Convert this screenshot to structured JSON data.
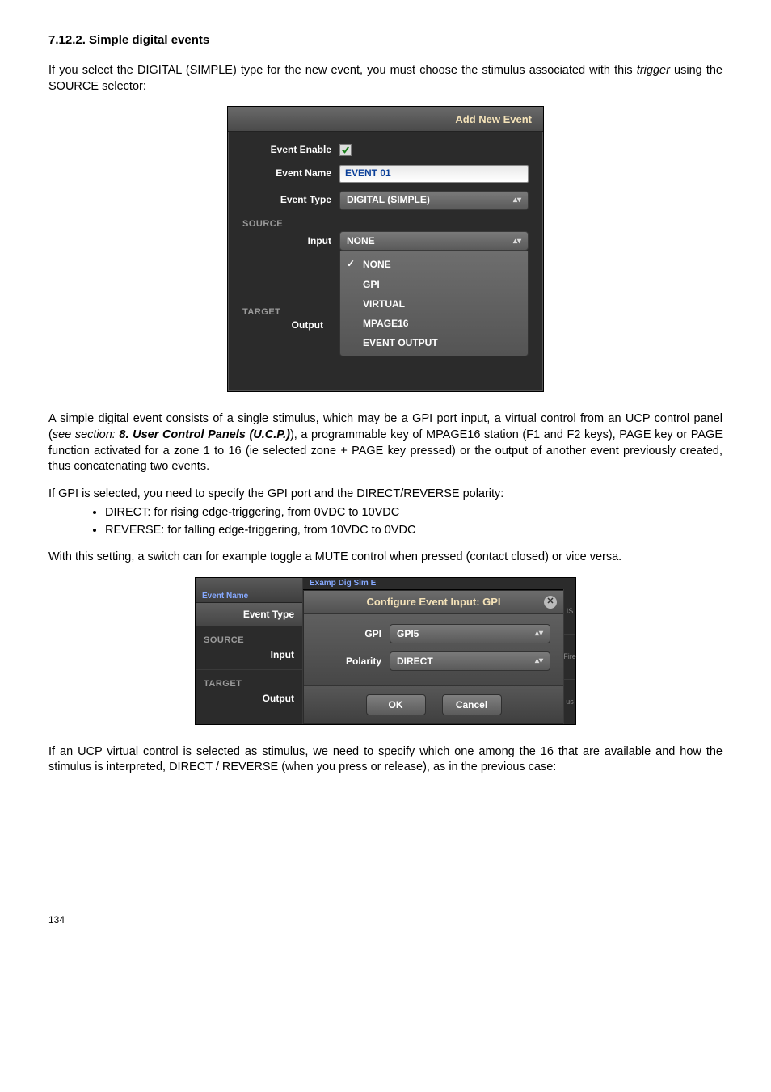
{
  "doc": {
    "heading": "7.12.2. Simple digital events",
    "para1a": "If you select the DIGITAL (SIMPLE) type for the new event, you must choose the stimulus associated with this ",
    "para1_trigger": "trigger",
    "para1b": " using the SOURCE selector:",
    "para2a": "A simple digital event consists of a single stimulus, which may be a GPI port input, a virtual control from an UCP control panel (",
    "para2_see": "see section: ",
    "para2_ref": "8. User Control Panels (U.C.P.)",
    "para2b": "), a programmable key of MPAGE16 station (F1 and F2 keys), PAGE key or PAGE function activated for a zone 1 to 16 (ie selected zone + PAGE key pressed) or the output of another event previously created, thus concatenating two events.",
    "para3": "If GPI is selected, you need to specify the GPI port and the DIRECT/REVERSE polarity:",
    "bullet1": "DIRECT: for rising edge-triggering, from 0VDC to 10VDC",
    "bullet2": "REVERSE: for falling edge-triggering, from 10VDC to 0VDC",
    "para4": "With this setting, a switch can for example toggle a MUTE control when pressed (contact closed) or vice versa.",
    "para5": "If an UCP virtual control is selected as stimulus, we need to specify which one among the 16 that are available and how the stimulus is interpreted, DIRECT / REVERSE (when you press or release), as in the previous case:",
    "pagenum": "134"
  },
  "panel1": {
    "title": "Add New Event",
    "event_enable_label": "Event Enable",
    "event_name_label": "Event Name",
    "event_name_value": "EVENT 01",
    "event_type_label": "Event Type",
    "event_type_value": "DIGITAL (SIMPLE)",
    "source_header": "SOURCE",
    "input_label": "Input",
    "input_value": "NONE",
    "options": [
      "NONE",
      "GPI",
      "VIRTUAL",
      "MPAGE16",
      "EVENT OUTPUT"
    ],
    "target_header": "TARGET",
    "output_label": "Output"
  },
  "panel2": {
    "left_crumb": "Event Name",
    "left_event_type": "Event Type",
    "left_source": "SOURCE",
    "left_input": "Input",
    "left_target": "TARGET",
    "left_output": "Output",
    "right_crumb": "Examp Dig Sim E",
    "dialog_title": "Configure Event Input: GPI",
    "gpi_label": "GPI",
    "gpi_value": "GPI5",
    "polarity_label": "Polarity",
    "polarity_value": "DIRECT",
    "ok": "OK",
    "cancel": "Cancel",
    "edge1": "IS",
    "edge2": "Fire",
    "edge3": "us"
  }
}
